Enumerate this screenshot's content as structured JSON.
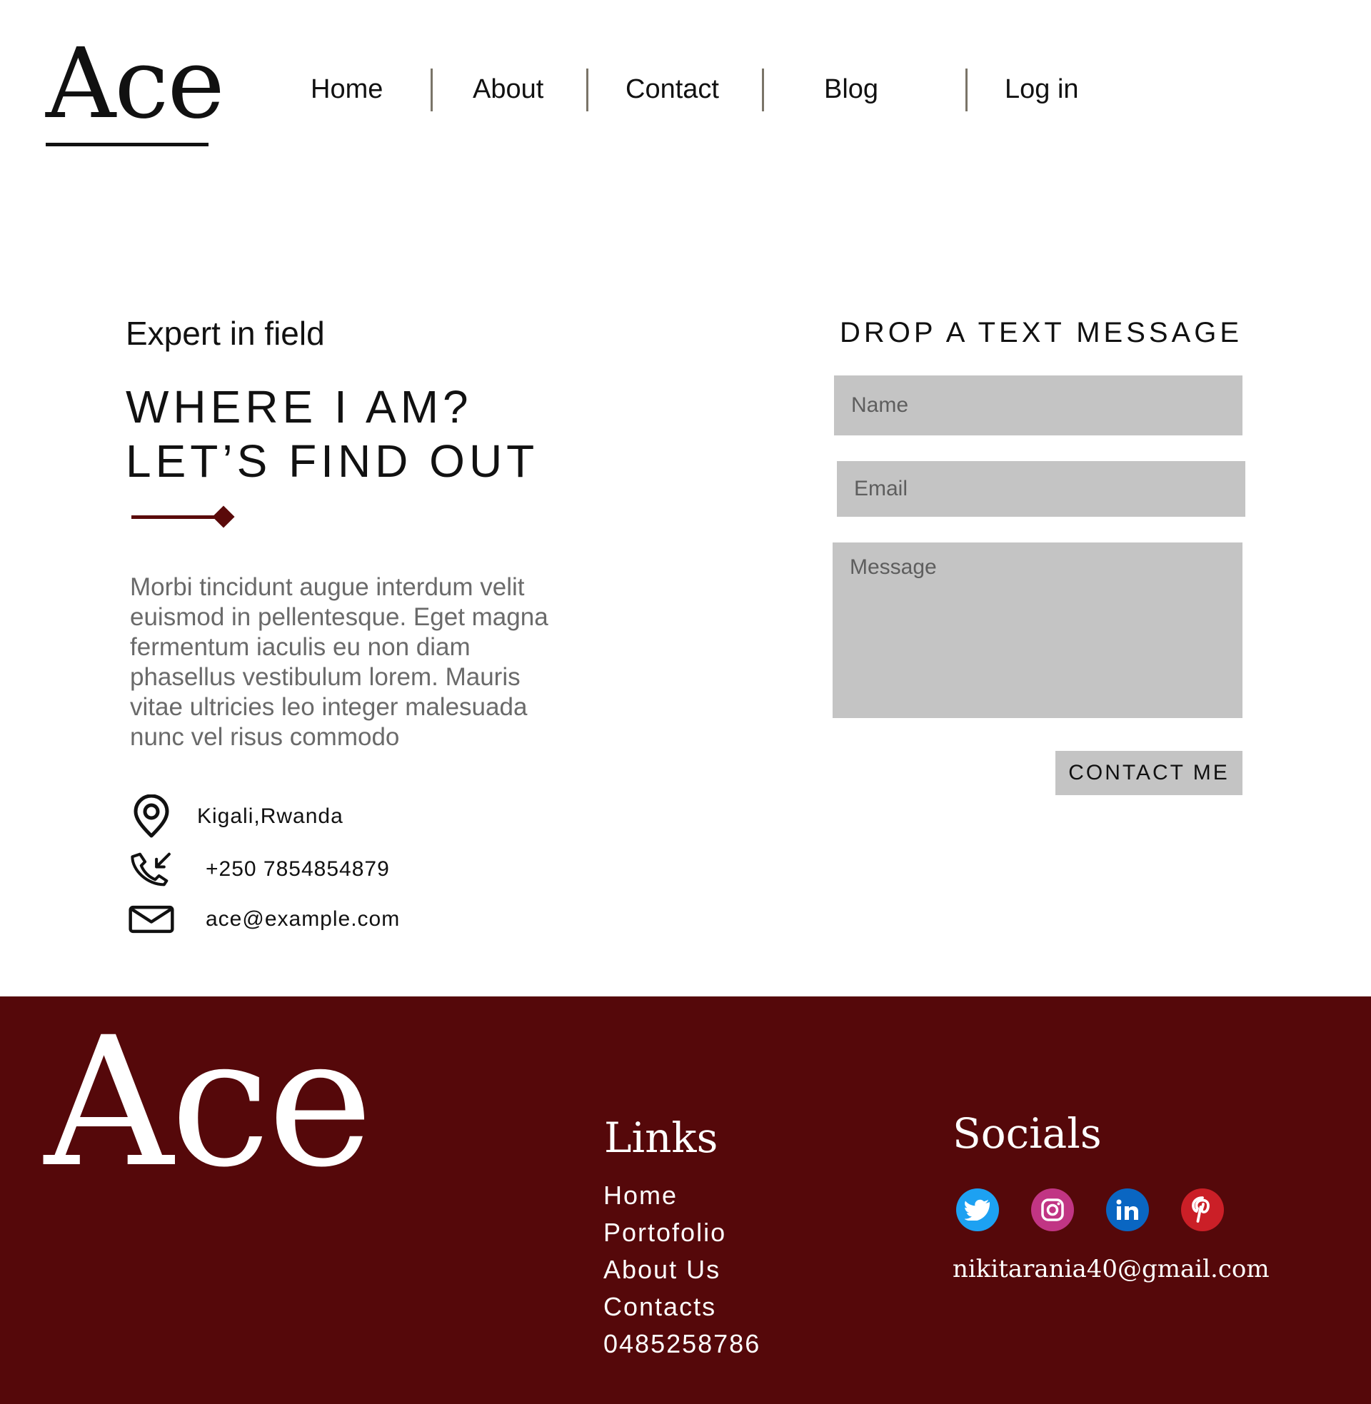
{
  "header": {
    "logo": "Ace",
    "nav": [
      "Home",
      "About",
      "Contact",
      "Blog",
      "Log in"
    ]
  },
  "hero": {
    "eyebrow": "Expert in field",
    "headline_line1": "WHERE I AM?",
    "headline_line2": "LET’S FIND OUT",
    "body": "Morbi tincidunt augue interdum velit euismod in pellentesque. Eget magna fermentum iaculis eu non diam phasellus vestibulum lorem. Mauris vitae ultricies leo integer malesuada nunc vel risus commodo"
  },
  "contact_info": {
    "location": "Kigali,Rwanda",
    "phone": "+250 7854854879",
    "email": "ace@example.com",
    "icons": [
      "location-pin-icon",
      "phone-icon",
      "mail-icon"
    ]
  },
  "form": {
    "title": "DROP A TEXT MESSAGE",
    "name_placeholder": "Name",
    "email_placeholder": "Email",
    "message_placeholder": "Message",
    "submit_label": "CONTACT ME"
  },
  "footer": {
    "logo": "Ace",
    "links_title": "Links",
    "links": [
      "Home",
      "Portofolio",
      "About Us",
      "Contacts",
      "0485258786"
    ],
    "socials_title": "Socials",
    "socials": [
      {
        "name": "twitter-icon",
        "color": "#1da1f2"
      },
      {
        "name": "instagram-icon",
        "color": "#c13584"
      },
      {
        "name": "linkedin-icon",
        "color": "#0a66c2"
      },
      {
        "name": "pinterest-icon",
        "color": "#cb1f27"
      }
    ],
    "email": "nikitarania40@gmail.com"
  },
  "colors": {
    "accent": "#55080a",
    "field_bg": "#c4c4c4",
    "divider": "#7a7468"
  }
}
